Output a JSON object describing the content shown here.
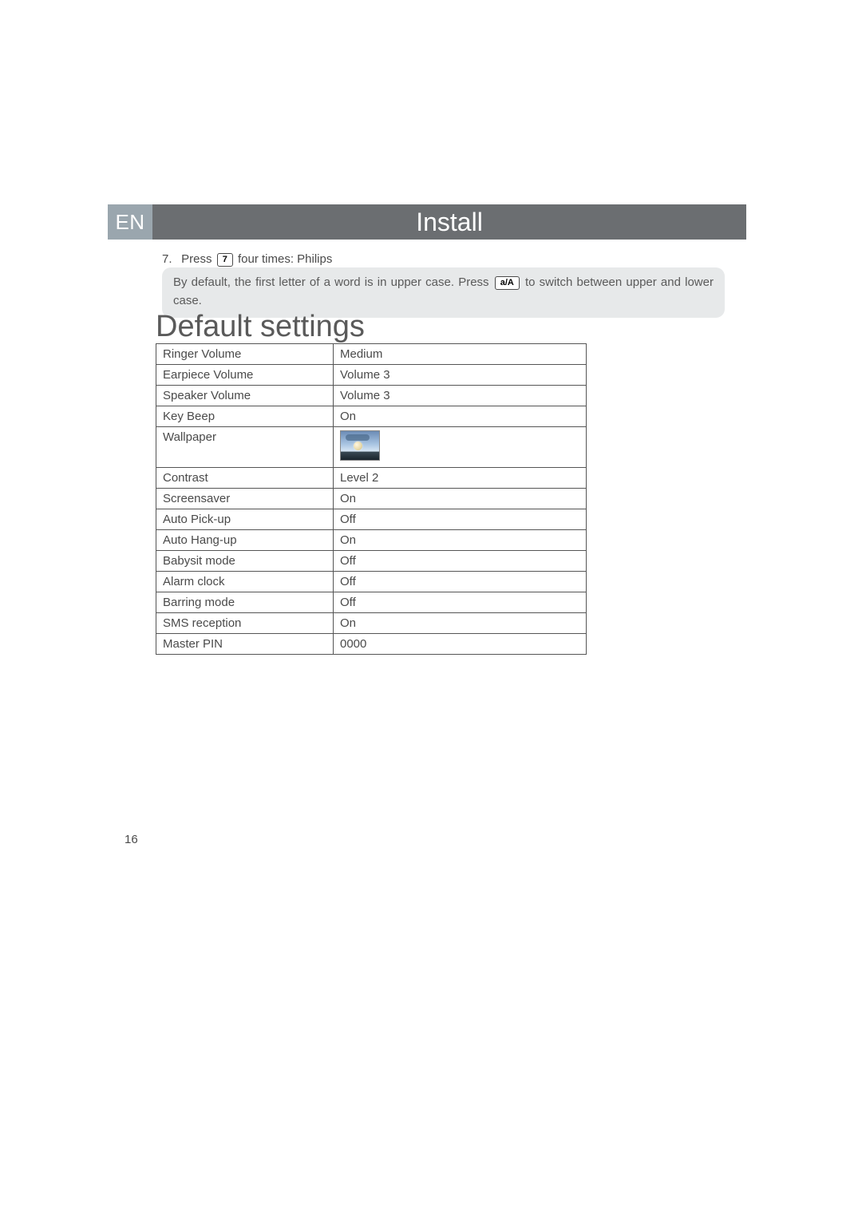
{
  "header": {
    "language_code": "EN",
    "title": "Install"
  },
  "step7": {
    "number": "7.",
    "press_label": "Press",
    "key_glyph": "7",
    "after_key": "four times: Philips"
  },
  "note": {
    "text_before": "By default, the first letter of a word is in upper case. Press",
    "key_glyph": "a/A",
    "text_after": "to switch between upper and lower case."
  },
  "section_heading": "Default settings",
  "settings": [
    {
      "label": "Ringer Volume",
      "value": "Medium"
    },
    {
      "label": "Earpiece Volume",
      "value": "Volume 3"
    },
    {
      "label": "Speaker Volume",
      "value": "Volume 3"
    },
    {
      "label": "Key Beep",
      "value": "On"
    },
    {
      "label": "Wallpaper",
      "value": ""
    },
    {
      "label": "Contrast",
      "value": "Level 2"
    },
    {
      "label": "Screensaver",
      "value": "On"
    },
    {
      "label": "Auto Pick-up",
      "value": "Off"
    },
    {
      "label": "Auto Hang-up",
      "value": "On"
    },
    {
      "label": "Babysit mode",
      "value": "Off"
    },
    {
      "label": "Alarm clock",
      "value": "Off"
    },
    {
      "label": "Barring mode",
      "value": "Off"
    },
    {
      "label": "SMS reception",
      "value": "On"
    },
    {
      "label": "Master PIN",
      "value": "0000"
    }
  ],
  "page_number": "16"
}
